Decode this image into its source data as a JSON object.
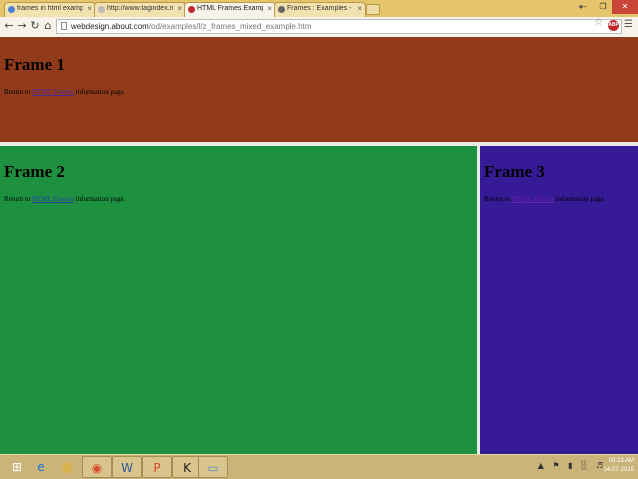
{
  "browser": {
    "tabs": [
      {
        "label": "frames in html example -",
        "active": false,
        "icon_color": "#4a7fd0"
      },
      {
        "label": "http://www.tagindex.net/",
        "active": false,
        "icon_color": "#bbbbbb"
      },
      {
        "label": "HTML Frames Example - W",
        "active": true,
        "icon_color": "#c0282e"
      },
      {
        "label": "Frames : Examples - HTML",
        "active": false,
        "icon_color": "#666666"
      }
    ],
    "close_glyph": "×",
    "url_host": "webdesign.about.com",
    "url_path": "/od/examples/l/z_frames_mixed_example.htm"
  },
  "page": {
    "frame1": {
      "heading": "Frame 1",
      "text_before": "Return to ",
      "link": "HTML Frames",
      "text_after": " information page."
    },
    "frame2": {
      "heading": "Frame 2",
      "text_before": "Return to ",
      "link": "HTML Frames",
      "text_after": " information page."
    },
    "frame3": {
      "heading": "Frame 3",
      "text_before": "Return to ",
      "link": "HTML Frames",
      "text_after": " information page."
    }
  },
  "taskbar": {
    "time": "09:23 AM",
    "date": "14-07-2015",
    "apps": [
      "windows-start-icon",
      "internet-explorer-icon",
      "file-explorer-icon",
      "chrome-icon",
      "word-icon",
      "powerpoint-icon",
      "k7-icon",
      "app-icon"
    ]
  },
  "colors": {
    "frame1": "#923b1b",
    "frame2": "#1e9140",
    "frame3": "#371a95"
  }
}
